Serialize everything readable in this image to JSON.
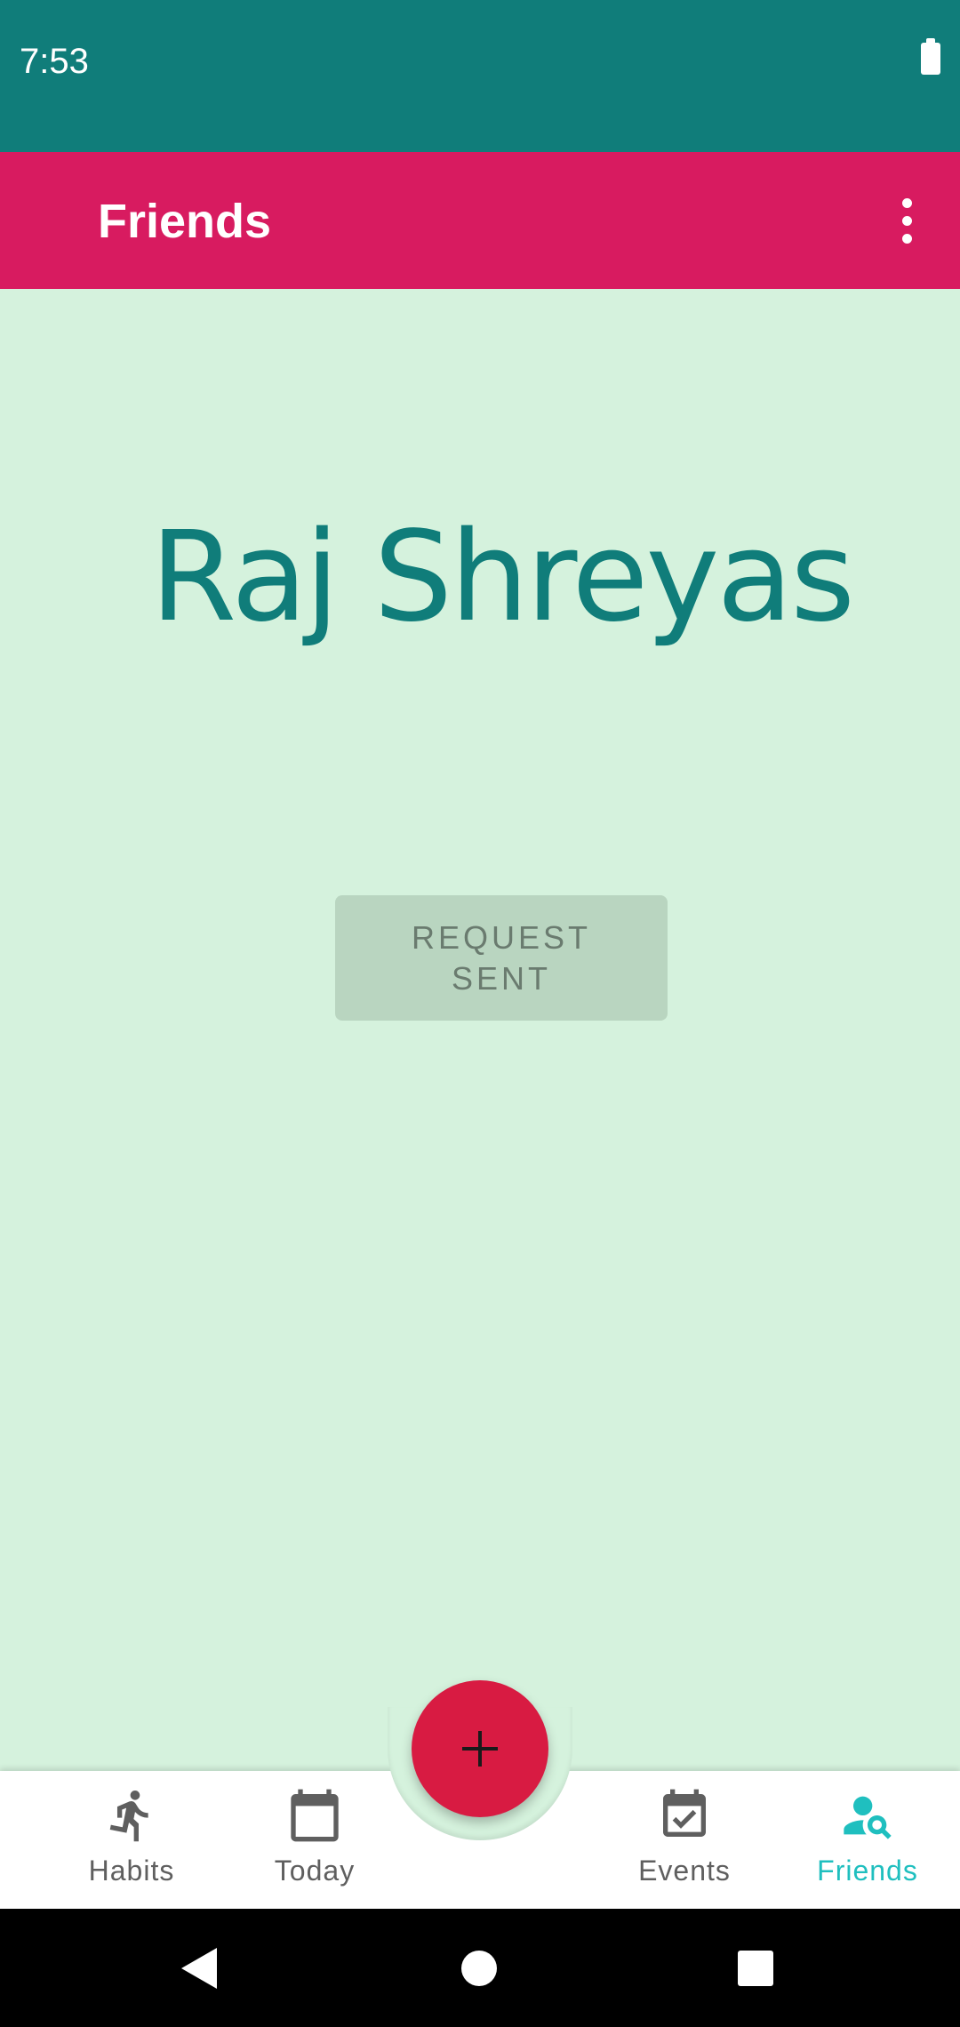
{
  "status_bar": {
    "time": "7:53"
  },
  "app_bar": {
    "title": "Friends"
  },
  "profile": {
    "name": "Raj Shreyas"
  },
  "request_button": {
    "label": "REQUEST SENT"
  },
  "bottom_nav": {
    "items": [
      {
        "label": "Habits",
        "icon": "run-icon",
        "active": false
      },
      {
        "label": "Today",
        "icon": "calendar-icon",
        "active": false
      },
      {
        "label": "Events",
        "icon": "event-check-icon",
        "active": false
      },
      {
        "label": "Friends",
        "icon": "person-search-icon",
        "active": true
      }
    ],
    "fab_icon": "plus-icon"
  },
  "colors": {
    "status_bar": "#107d7a",
    "app_bar": "#d81b60",
    "background": "#d5f2dd",
    "name_text": "#107d7a",
    "fab": "#d81b42",
    "active_nav": "#1fbfbf",
    "inactive_nav": "#5f5f5f"
  }
}
